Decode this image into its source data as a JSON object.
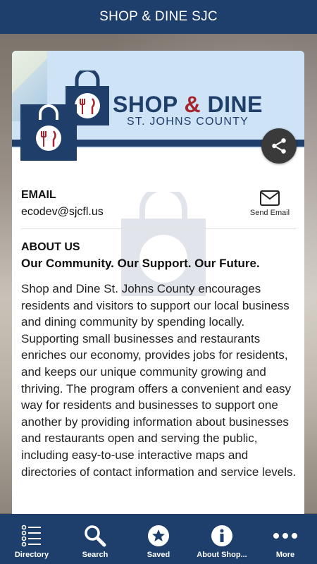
{
  "app": {
    "title": "SHOP & DINE SJC"
  },
  "banner": {
    "brand_shop": "SHOP",
    "brand_amp": "&",
    "brand_dine": "DINE",
    "brand_sub": "ST. JOHNS COUNTY"
  },
  "email": {
    "label": "EMAIL",
    "value": "ecodev@sjcfl.us",
    "send_label": "Send Email"
  },
  "about": {
    "label": "ABOUT US",
    "tagline": "Our Community. Our Support. Our Future.",
    "description": "Shop and Dine St. Johns County encourages residents and visitors to support our local business and dining community by spending locally. Supporting small businesses and restaurants enriches our economy, provides jobs for residents, and keeps our unique community growing and thriving. The program offers a convenient and easy way for residents and businesses to support one another by providing information about businesses and restaurants open and serving the public, including easy-to-use interactive maps and directories of contact information and service levels."
  },
  "nav": {
    "tabs": [
      {
        "label": "Directory",
        "icon": "list-icon"
      },
      {
        "label": "Search",
        "icon": "search-icon"
      },
      {
        "label": "Saved",
        "icon": "star-icon"
      },
      {
        "label": "About Shop...",
        "icon": "info-icon"
      },
      {
        "label": "More",
        "icon": "more-icon"
      }
    ]
  },
  "colors": {
    "primary": "#1e3f6c",
    "accent": "#a5262e",
    "banner_bg": "#cfe3f6"
  }
}
